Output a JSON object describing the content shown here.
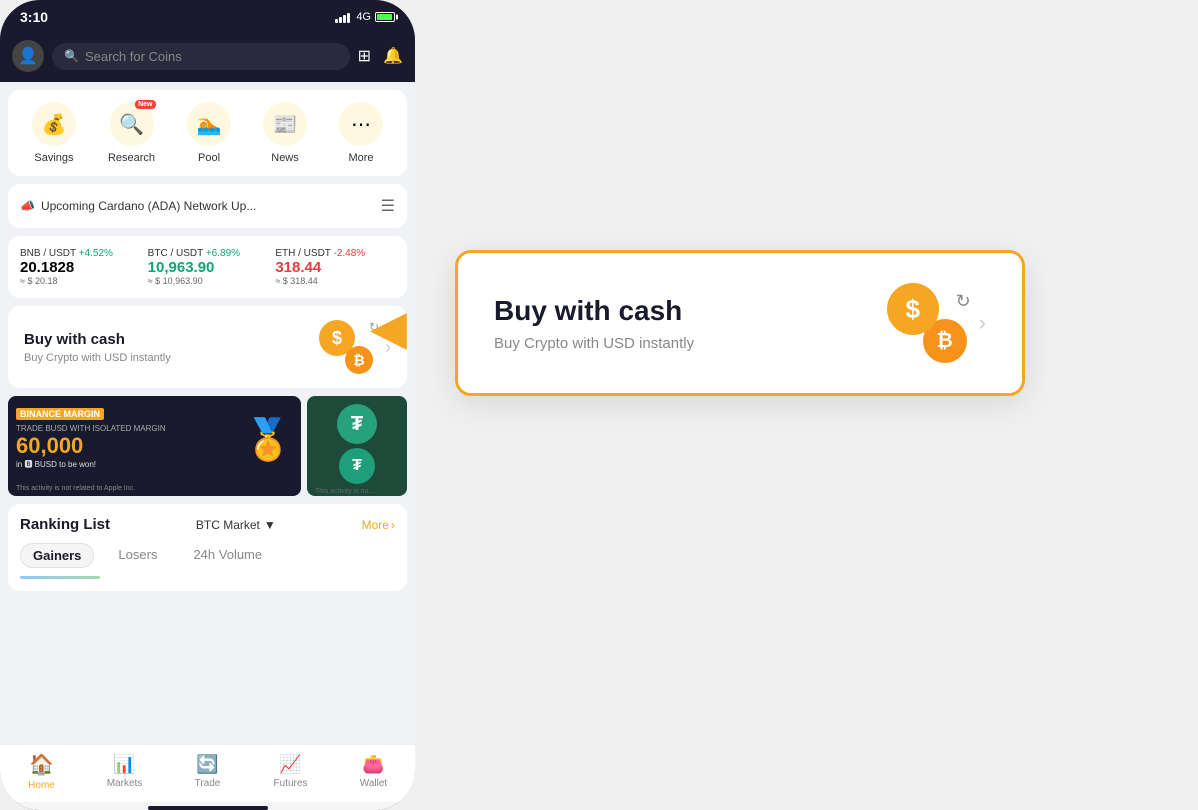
{
  "status": {
    "time": "3:10",
    "network": "4G"
  },
  "search": {
    "placeholder": "Search for Coins"
  },
  "quick_menu": {
    "items": [
      {
        "label": "Savings",
        "icon": "💰",
        "new": false
      },
      {
        "label": "Research",
        "icon": "🔍",
        "new": true
      },
      {
        "label": "Pool",
        "icon": "🏊",
        "new": false
      },
      {
        "label": "News",
        "icon": "📰",
        "new": false
      },
      {
        "label": "More",
        "icon": "⋯",
        "new": false
      }
    ]
  },
  "announcement": {
    "text": "Upcoming Cardano (ADA) Network Up..."
  },
  "tickers": [
    {
      "pair": "BNB / USDT",
      "change": "+4.52%",
      "price": "20.1828",
      "usd": "≈ $ 20.18",
      "positive": true
    },
    {
      "pair": "BTC / USDT",
      "change": "+6.89%",
      "price": "10,963.90",
      "usd": "≈ $ 10,963.90",
      "positive": true
    },
    {
      "pair": "ETH / USDT",
      "change": "-2.48%",
      "price": "318.44",
      "usd": "≈ $ 318.44",
      "positive": false
    }
  ],
  "buy_cash": {
    "title": "Buy with cash",
    "subtitle": "Buy Crypto with USD instantly"
  },
  "banner": {
    "left": {
      "logo": "BINANCE MARGIN",
      "subtitle": "TRADE BUSD WITH ISOLATED MARGIN",
      "amount": "60,000",
      "unit": "in BUSD to be won!",
      "disclaimer": "This activity is not related to Apple Inc."
    },
    "right": {
      "disclaimer": "This activity is no..."
    }
  },
  "ranking": {
    "title": "Ranking List",
    "market": "BTC Market",
    "more_label": "More",
    "tabs": [
      {
        "label": "Gainers",
        "active": true
      },
      {
        "label": "Losers",
        "active": false
      },
      {
        "label": "24h Volume",
        "active": false
      }
    ]
  },
  "bottom_nav": {
    "items": [
      {
        "label": "Home",
        "icon": "🏠",
        "active": true
      },
      {
        "label": "Markets",
        "icon": "📊",
        "active": false
      },
      {
        "label": "Trade",
        "icon": "🔄",
        "active": false
      },
      {
        "label": "Futures",
        "icon": "📈",
        "active": false
      },
      {
        "label": "Wallet",
        "icon": "👛",
        "active": false
      }
    ]
  },
  "popup": {
    "title": "Buy with cash",
    "subtitle": "Buy Crypto with USD instantly"
  }
}
